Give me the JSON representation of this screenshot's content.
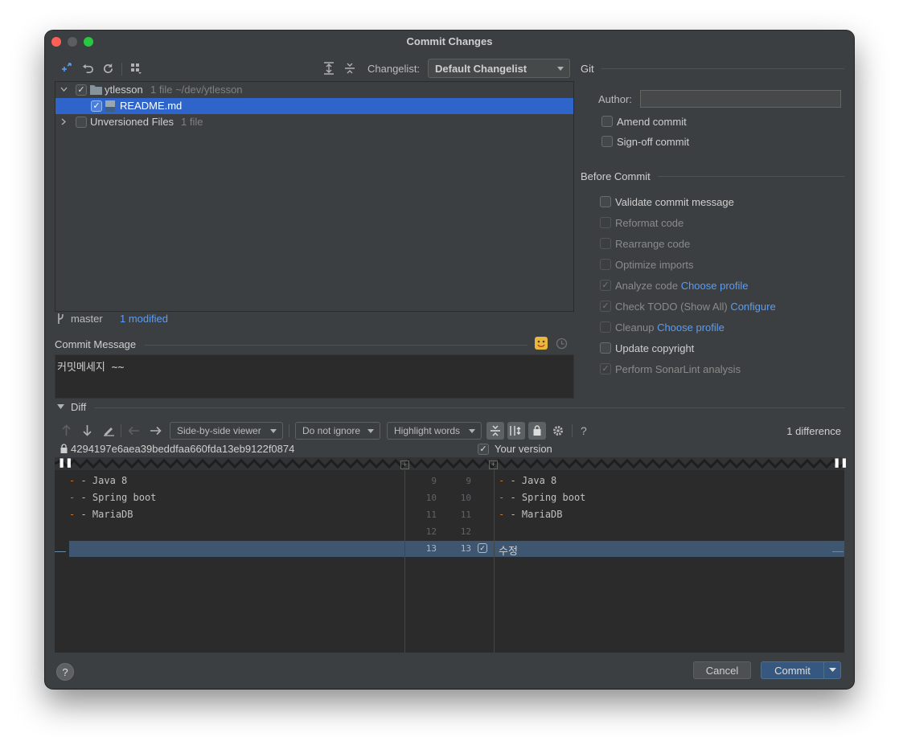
{
  "window": {
    "title": "Commit Changes"
  },
  "toolbar": {
    "changelist_label": "Changelist:",
    "changelist_value": "Default Changelist"
  },
  "tree": {
    "root": {
      "name": "ytlesson",
      "meta": "1 file  ~/dev/ytlesson"
    },
    "file": {
      "name": "README.md"
    },
    "unversioned": {
      "name": "Unversioned Files",
      "meta": "1 file"
    }
  },
  "branch": {
    "name": "master",
    "status": "1 modified"
  },
  "commit_message": {
    "label": "Commit Message",
    "value": "커밋메세지 ~~"
  },
  "git": {
    "section": "Git",
    "author_label": "Author:",
    "author_value": "",
    "amend": "Amend commit",
    "signoff": "Sign-off commit"
  },
  "before_commit": {
    "section": "Before Commit",
    "items": [
      {
        "label": "Validate commit message",
        "link": ""
      },
      {
        "label": "Reformat code",
        "link": ""
      },
      {
        "label": "Rearrange code",
        "link": ""
      },
      {
        "label": "Optimize imports",
        "link": ""
      },
      {
        "label": "Analyze code",
        "link": "Choose profile"
      },
      {
        "label": "Check TODO (Show All)",
        "link": "Configure"
      },
      {
        "label": "Cleanup",
        "link": "Choose profile"
      },
      {
        "label": "Update copyright",
        "link": ""
      },
      {
        "label": "Perform SonarLint analysis",
        "link": ""
      }
    ]
  },
  "diff": {
    "section": "Diff",
    "viewer": "Side-by-side viewer",
    "ignore": "Do not ignore",
    "highlight": "Highlight words",
    "help": "?",
    "count": "1 difference",
    "left_hash": "4294197e6aea39beddfaa660fda13eb9122f0874",
    "right_title": "Your version",
    "left_lines": [
      "- Java 8",
      "- Spring boot",
      "- MariaDB",
      "",
      ""
    ],
    "right_lines": [
      "- Java 8",
      "- Spring boot",
      "- MariaDB",
      "",
      "수정"
    ],
    "left_nums": [
      "9",
      "10",
      "11",
      "12",
      "13"
    ],
    "right_nums": [
      "9",
      "10",
      "11",
      "12",
      "13"
    ]
  },
  "buttons": {
    "help": "?",
    "cancel": "Cancel",
    "commit": "Commit"
  },
  "colors": {
    "accent": "#4b6eaf",
    "selection": "#2f65ca",
    "changed_line": "#3f5670",
    "panel": "#3c3f41",
    "editor": "#2b2b2b"
  }
}
